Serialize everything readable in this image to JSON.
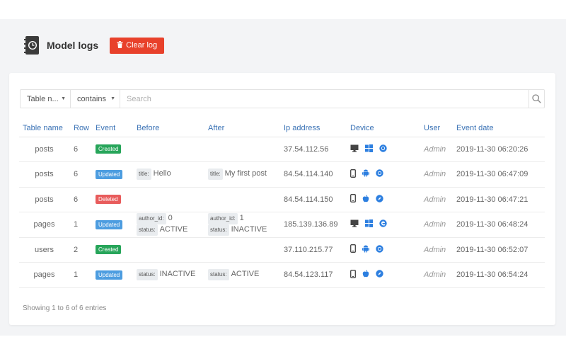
{
  "header": {
    "title": "Model logs",
    "clear_label": "Clear log"
  },
  "filter": {
    "column_select": "Table n...",
    "operator_select": "contains",
    "search_placeholder": "Search"
  },
  "table": {
    "columns": [
      "Table name",
      "Row",
      "Event",
      "Before",
      "After",
      "Ip address",
      "Device",
      "User",
      "Event date"
    ],
    "rows": [
      {
        "table_name": "posts",
        "row": "6",
        "event": "Created",
        "before": [],
        "after": [],
        "ip": "37.54.112.56",
        "device": [
          "desktop-icon",
          "windows-icon",
          "chrome-icon"
        ],
        "user": "Admin",
        "date": "2019-11-30 06:20:26"
      },
      {
        "table_name": "posts",
        "row": "6",
        "event": "Updated",
        "before": [
          {
            "k": "title:",
            "v": "Hello"
          }
        ],
        "after": [
          {
            "k": "title:",
            "v": "My first post"
          }
        ],
        "ip": "84.54.114.140",
        "device": [
          "mobile-icon",
          "android-icon",
          "chrome-icon"
        ],
        "user": "Admin",
        "date": "2019-11-30 06:47:09"
      },
      {
        "table_name": "posts",
        "row": "6",
        "event": "Deleted",
        "before": [],
        "after": [],
        "ip": "84.54.114.150",
        "device": [
          "mobile-icon",
          "apple-icon",
          "safari-icon"
        ],
        "user": "Admin",
        "date": "2019-11-30 06:47:21"
      },
      {
        "table_name": "pages",
        "row": "1",
        "event": "Updated",
        "before": [
          {
            "k": "author_id:",
            "v": "0"
          },
          {
            "k": "status:",
            "v": "ACTIVE"
          }
        ],
        "after": [
          {
            "k": "author_id:",
            "v": "1"
          },
          {
            "k": "status:",
            "v": "INACTIVE"
          }
        ],
        "ip": "185.139.136.89",
        "device": [
          "desktop-icon",
          "windows-icon",
          "edge-icon"
        ],
        "user": "Admin",
        "date": "2019-11-30 06:48:24"
      },
      {
        "table_name": "users",
        "row": "2",
        "event": "Created",
        "before": [],
        "after": [],
        "ip": "37.110.215.77",
        "device": [
          "mobile-icon",
          "android-icon",
          "chrome-icon"
        ],
        "user": "Admin",
        "date": "2019-11-30 06:52:07"
      },
      {
        "table_name": "pages",
        "row": "1",
        "event": "Updated",
        "before": [
          {
            "k": "status:",
            "v": "INACTIVE"
          }
        ],
        "after": [
          {
            "k": "status:",
            "v": "ACTIVE"
          }
        ],
        "ip": "84.54.123.117",
        "device": [
          "mobile-icon",
          "apple-icon",
          "safari-icon"
        ],
        "user": "Admin",
        "date": "2019-11-30 06:54:24"
      }
    ]
  },
  "footer": {
    "info": "Showing 1 to 6 of 6 entries"
  },
  "colors": {
    "accent": "#3a72b5",
    "danger_button": "#e8412b",
    "badge_created": "#27a55a",
    "badge_updated": "#4d9de0",
    "badge_deleted": "#e85c5c",
    "icon_blue": "#2d7fe0"
  }
}
